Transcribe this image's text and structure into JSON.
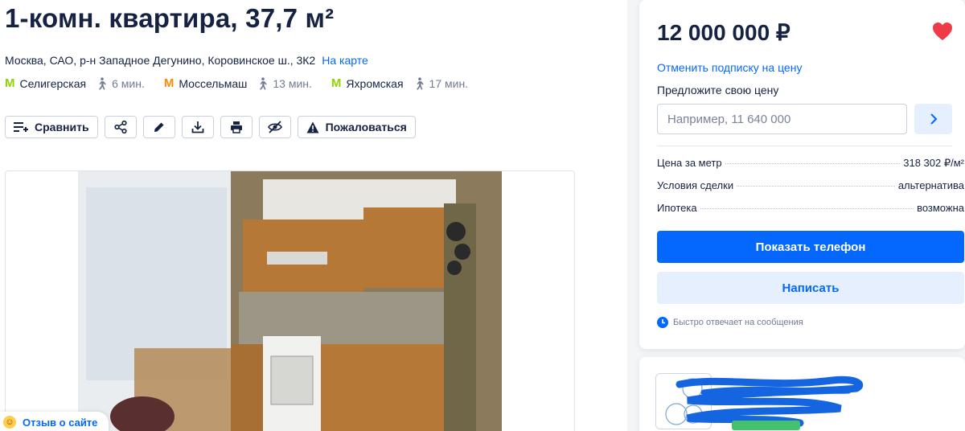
{
  "listing": {
    "title": "1-комн. квартира, 37,7 м²",
    "address": "Москва, САО, р-н Западное Дегунино, Коровинское ш., 3К2",
    "map_link": "На карте",
    "metro": [
      {
        "name": "Селигерская",
        "walk": "6 мин.",
        "color": "#8fd400"
      },
      {
        "name": "Моссельмаш",
        "walk": "13 мин.",
        "color": "#ff8a00"
      },
      {
        "name": "Яхромская",
        "walk": "17 мин.",
        "color": "#8fd400"
      }
    ],
    "metro_logo": "М"
  },
  "toolbar": {
    "compare_label": "Сравнить",
    "report_label": "Пожаловаться",
    "icons": [
      "compare-icon",
      "share-icon",
      "edit-icon",
      "download-icon",
      "print-icon",
      "hide-icon",
      "warning-icon"
    ]
  },
  "feedback": {
    "label": "Отзыв о сайте"
  },
  "price_card": {
    "price": "12 000 000 ₽",
    "favorite_color": "#ef3b47",
    "unsubscribe": "Отменить подписку на цену",
    "offer_label": "Предложите свою цену",
    "offer_placeholder": "Например, 11 640 000",
    "details": [
      {
        "label": "Цена за метр",
        "value": "318 302 ₽/м²"
      },
      {
        "label": "Условия сделки",
        "value": "альтернатива"
      },
      {
        "label": "Ипотека",
        "value": "возможна"
      }
    ],
    "phone_button": "Показать телефон",
    "write_button": "Написать",
    "fast_reply": "Быстро отвечает на сообщения"
  },
  "colors": {
    "accent": "#0468ff",
    "accent_light": "#e6effe",
    "text": "#152242",
    "muted": "#707a95"
  }
}
